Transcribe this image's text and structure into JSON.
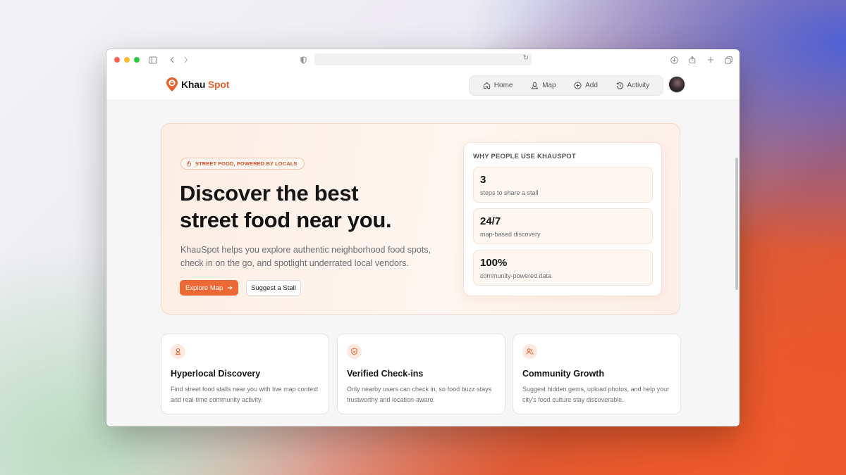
{
  "header": {
    "logo_part1": "Khau",
    "logo_part2": "Spot",
    "nav": [
      {
        "label": "Home",
        "icon": "home-icon"
      },
      {
        "label": "Map",
        "icon": "map-pin-icon"
      },
      {
        "label": "Add",
        "icon": "plus-circle-icon"
      },
      {
        "label": "Activity",
        "icon": "history-icon"
      }
    ]
  },
  "hero": {
    "badge": "STREET FOOD, POWERED BY LOCALS",
    "title_line1": "Discover the best",
    "title_line2": "street food near you.",
    "description": "KhauSpot helps you explore authentic neighborhood food spots, check in on the go, and spotlight underrated local vendors.",
    "primary_button": "Explore Map",
    "secondary_button": "Suggest a Stall"
  },
  "stats": {
    "title": "WHY PEOPLE USE KHAUSPOT",
    "items": [
      {
        "value": "3",
        "label": "steps to share a stall"
      },
      {
        "value": "24/7",
        "label": "map-based discovery"
      },
      {
        "value": "100%",
        "label": "community-powered data"
      }
    ]
  },
  "features": [
    {
      "title": "Hyperlocal Discovery",
      "description": "Find street  food stalls near you with live map context and real-time community activity.",
      "icon": "location-person-icon"
    },
    {
      "title": "Verified Check-ins",
      "description": "Only nearby users can check in, so food buzz stays trustworthy and location-aware.",
      "icon": "shield-check-icon"
    },
    {
      "title": "Community Growth",
      "description": "Suggest hidden gems, upload photos, and help your city's food culture stay discoverable.",
      "icon": "users-icon"
    }
  ],
  "colors": {
    "accent": "#ec6935",
    "accent_light": "#fde9df"
  }
}
